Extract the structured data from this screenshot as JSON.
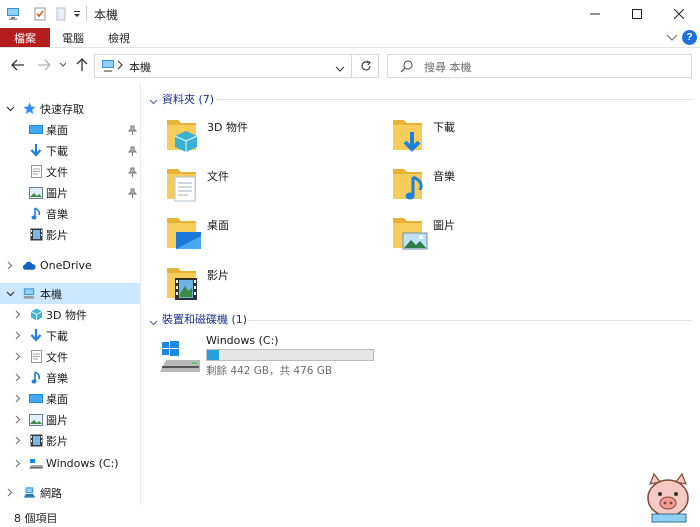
{
  "window": {
    "title": "本機",
    "minimize_icon": "minimize-icon",
    "maximize_icon": "maximize-icon",
    "close_icon": "close-icon"
  },
  "ribbon": {
    "tabs": [
      "檔案",
      "電腦",
      "檢視"
    ]
  },
  "address_bar": {
    "path": "本機",
    "search_placeholder": "搜尋 本機"
  },
  "nav_pane": {
    "quick_access": {
      "label": "快速存取",
      "items": [
        {
          "label": "桌面",
          "icon": "desktop-icon",
          "pinned": true
        },
        {
          "label": "下載",
          "icon": "download-icon",
          "pinned": true
        },
        {
          "label": "文件",
          "icon": "document-icon",
          "pinned": true
        },
        {
          "label": "圖片",
          "icon": "picture-icon",
          "pinned": true
        },
        {
          "label": "音樂",
          "icon": "music-icon",
          "pinned": false
        },
        {
          "label": "影片",
          "icon": "video-icon",
          "pinned": false
        }
      ]
    },
    "onedrive_label": "OneDrive",
    "this_pc": {
      "label": "本機",
      "items": [
        {
          "label": "3D 物件",
          "icon": "3d-objects-icon"
        },
        {
          "label": "下載",
          "icon": "download-icon"
        },
        {
          "label": "文件",
          "icon": "document-icon"
        },
        {
          "label": "音樂",
          "icon": "music-icon"
        },
        {
          "label": "桌面",
          "icon": "desktop-icon"
        },
        {
          "label": "圖片",
          "icon": "picture-icon"
        },
        {
          "label": "影片",
          "icon": "video-icon"
        },
        {
          "label": "Windows (C:)",
          "icon": "drive-icon"
        }
      ]
    },
    "network_label": "網路"
  },
  "content": {
    "folders_header": "資料夾 (7)",
    "folders": [
      {
        "label": "3D 物件",
        "icon": "3d-objects-folder-icon"
      },
      {
        "label": "下載",
        "icon": "downloads-folder-icon"
      },
      {
        "label": "文件",
        "icon": "documents-folder-icon"
      },
      {
        "label": "音樂",
        "icon": "music-folder-icon"
      },
      {
        "label": "桌面",
        "icon": "desktop-folder-icon"
      },
      {
        "label": "圖片",
        "icon": "pictures-folder-icon"
      },
      {
        "label": "影片",
        "icon": "videos-folder-icon"
      }
    ],
    "devices_header": "裝置和磁碟機 (1)",
    "drive": {
      "name": "Windows (C:)",
      "free_text": "剩餘 442 GB，共 476 GB",
      "used_fraction": 0.07
    }
  },
  "status_bar": {
    "item_count": "8 個項目"
  },
  "colors": {
    "file_tab": "#b51c1c",
    "selection": "#cce8ff",
    "group_header": "#1e3287",
    "drive_bar": "#26a0da",
    "folder": "#f0c24a"
  }
}
